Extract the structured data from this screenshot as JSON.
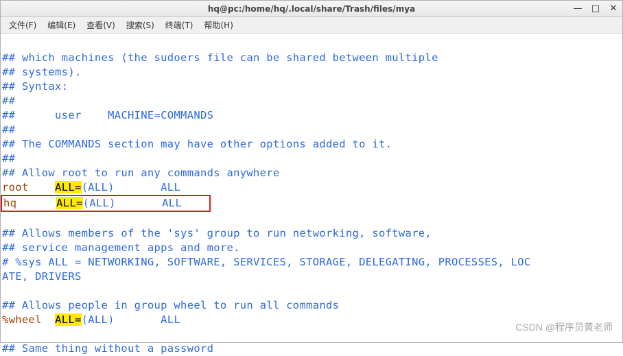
{
  "title": "hq@pc:/home/hq/.local/share/Trash/files/mya",
  "menus": [
    {
      "label": "文件(F)"
    },
    {
      "label": "编辑(E)"
    },
    {
      "label": "查看(V)"
    },
    {
      "label": "搜索(S)"
    },
    {
      "label": "终端(T)"
    },
    {
      "label": "帮助(H)"
    }
  ],
  "lines": {
    "l1": "## which machines (the sudoers file can be shared between multiple",
    "l2": "## systems).",
    "l3": "## Syntax:",
    "l4": "##",
    "l5": "##      user    MACHINE=COMMANDS",
    "l6": "##",
    "l7": "## The COMMANDS section may have other options added to it.",
    "l8": "##",
    "l9": "## Allow root to run any commands anywhere",
    "l10a": "root    ",
    "l10b": "ALL=",
    "l10c": "(ALL)       ALL",
    "l11a": "hq      ",
    "l11b": "ALL=",
    "l11c": "(ALL)       ALL",
    "l12": "## Allows members of the 'sys' group to run networking, software,",
    "l13": "## service management apps and more.",
    "l14": "# %sys ALL = NETWORKING, SOFTWARE, SERVICES, STORAGE, DELEGATING, PROCESSES, LOC",
    "l15": "ATE, DRIVERS",
    "l16": "## Allows people in group wheel to run all commands",
    "l17a": "%wheel  ",
    "l17b": "ALL=",
    "l17c": "(ALL)       ALL",
    "l18": "## Same thing without a password"
  },
  "watermark": "CSDN @程序员黄老师"
}
